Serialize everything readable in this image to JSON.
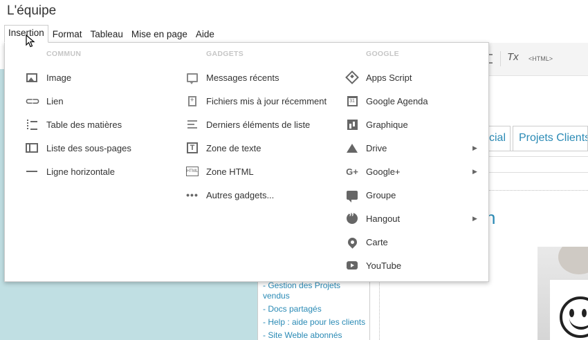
{
  "title": "L'équipe",
  "menubar": [
    {
      "label": "Insertion",
      "active": true
    },
    {
      "label": "Format"
    },
    {
      "label": "Tableau"
    },
    {
      "label": "Mise en page"
    },
    {
      "label": "Aide"
    }
  ],
  "dropdown": {
    "columns": [
      {
        "header": "COMMUN",
        "items": [
          {
            "label": "Image",
            "icon": "image-icon"
          },
          {
            "label": "Lien",
            "icon": "link-icon"
          },
          {
            "label": "Table des matières",
            "icon": "toc-icon"
          },
          {
            "label": "Liste des sous-pages",
            "icon": "subpages-icon"
          },
          {
            "label": "Ligne horizontale",
            "icon": "horizontal-line-icon"
          }
        ]
      },
      {
        "header": "GADGETS",
        "items": [
          {
            "label": "Messages récents",
            "icon": "message-icon"
          },
          {
            "label": "Fichiers mis à jour récemment",
            "icon": "file-icon"
          },
          {
            "label": "Derniers éléments de liste",
            "icon": "list-icon"
          },
          {
            "label": "Zone de texte",
            "icon": "text-box-icon"
          },
          {
            "label": "Zone HTML",
            "icon": "html-box-icon"
          },
          {
            "label": "Autres gadgets...",
            "icon": "more-dots-icon"
          }
        ]
      },
      {
        "header": "GOOGLE",
        "items": [
          {
            "label": "Apps Script",
            "icon": "apps-script-icon"
          },
          {
            "label": "Google Agenda",
            "icon": "calendar-icon"
          },
          {
            "label": "Graphique",
            "icon": "chart-icon"
          },
          {
            "label": "Drive",
            "icon": "drive-icon",
            "submenu": true
          },
          {
            "label": "Google+",
            "icon": "google-plus-icon",
            "submenu": true
          },
          {
            "label": "Groupe",
            "icon": "group-icon"
          },
          {
            "label": "Hangout",
            "icon": "hangout-icon",
            "submenu": true
          },
          {
            "label": "Carte",
            "icon": "map-pin-icon"
          },
          {
            "label": "YouTube",
            "icon": "youtube-icon"
          }
        ]
      }
    ],
    "calendar_icon_text": "31",
    "html_icon_text": "HTML",
    "textbox_icon_text": "T",
    "submenu_arrow": "▶"
  },
  "background": {
    "toolbar_html_label": "<HTML>",
    "toolbar_clear_format": "Tx",
    "tab_partial": "cial",
    "tab_projets": "Projets Clients",
    "heading_fragment": "n",
    "sidebar_links": [
      "- Gestion des Projets",
      "vendus",
      "- Docs partagés",
      "- Help : aide pour les clients",
      "- Site Weble abonnés"
    ]
  }
}
